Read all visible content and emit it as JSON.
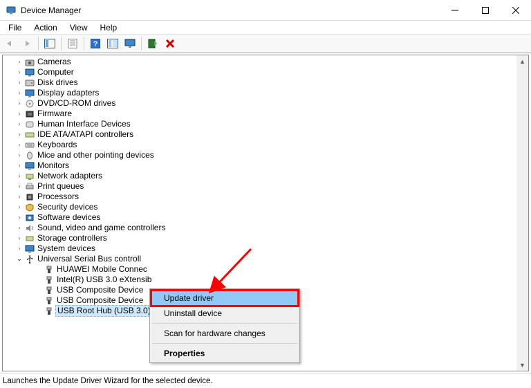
{
  "window": {
    "title": "Device Manager",
    "icon_name": "device-manager-icon"
  },
  "menus": [
    "File",
    "Action",
    "View",
    "Help"
  ],
  "toolbar_buttons": [
    {
      "name": "back-button",
      "icon": "arrow-left",
      "disabled": true
    },
    {
      "name": "forward-button",
      "icon": "arrow-right",
      "disabled": true
    },
    {
      "name": "sep"
    },
    {
      "name": "show-hide-console-tree-button",
      "icon": "pane-tree",
      "disabled": false
    },
    {
      "name": "sep"
    },
    {
      "name": "properties-button",
      "icon": "properties",
      "disabled": false
    },
    {
      "name": "sep"
    },
    {
      "name": "help-button",
      "icon": "help",
      "disabled": false
    },
    {
      "name": "show-all-button",
      "icon": "pane-all",
      "disabled": false
    },
    {
      "name": "show-monitor-button",
      "icon": "monitor",
      "disabled": false
    },
    {
      "name": "sep"
    },
    {
      "name": "scan-hardware-button",
      "icon": "scan",
      "disabled": false
    },
    {
      "name": "uninstall-button",
      "icon": "uninstall",
      "disabled": false
    }
  ],
  "tree": {
    "categories": [
      {
        "label": "Cameras",
        "icon": "camera-icon"
      },
      {
        "label": "Computer",
        "icon": "computer-icon"
      },
      {
        "label": "Disk drives",
        "icon": "disk-icon"
      },
      {
        "label": "Display adapters",
        "icon": "display-icon"
      },
      {
        "label": "DVD/CD-ROM drives",
        "icon": "dvd-icon"
      },
      {
        "label": "Firmware",
        "icon": "firmware-icon"
      },
      {
        "label": "Human Interface Devices",
        "icon": "hid-icon"
      },
      {
        "label": "IDE ATA/ATAPI controllers",
        "icon": "ide-icon"
      },
      {
        "label": "Keyboards",
        "icon": "keyboard-icon"
      },
      {
        "label": "Mice and other pointing devices",
        "icon": "mouse-icon"
      },
      {
        "label": "Monitors",
        "icon": "monitor-icon"
      },
      {
        "label": "Network adapters",
        "icon": "network-icon"
      },
      {
        "label": "Print queues",
        "icon": "printer-icon"
      },
      {
        "label": "Processors",
        "icon": "cpu-icon"
      },
      {
        "label": "Security devices",
        "icon": "security-icon"
      },
      {
        "label": "Software devices",
        "icon": "software-icon"
      },
      {
        "label": "Sound, video and game controllers",
        "icon": "sound-icon"
      },
      {
        "label": "Storage controllers",
        "icon": "storage-icon"
      },
      {
        "label": "System devices",
        "icon": "system-icon"
      }
    ],
    "expanded_category_label": "Universal Serial Bus controll",
    "expanded_category_icon": "usb-icon",
    "usb_children": [
      {
        "label": "HUAWEI Mobile Connec",
        "selected": false
      },
      {
        "label": "Intel(R) USB 3.0 eXtensib",
        "selected": false
      },
      {
        "label": "USB Composite Device",
        "selected": false
      },
      {
        "label": "USB Composite Device",
        "selected": false
      },
      {
        "label": "USB Root Hub (USB 3.0)",
        "selected": true
      }
    ]
  },
  "context_menu": {
    "items": [
      {
        "label": "Update driver",
        "selected": true,
        "highlight": true,
        "bold": false
      },
      {
        "label": "Uninstall device",
        "selected": false,
        "highlight": false,
        "bold": false
      },
      {
        "sep": true
      },
      {
        "label": "Scan for hardware changes",
        "selected": false,
        "highlight": false,
        "bold": false
      },
      {
        "sep": true
      },
      {
        "label": "Properties",
        "selected": false,
        "highlight": false,
        "bold": true
      }
    ]
  },
  "status_text": "Launches the Update Driver Wizard for the selected device.",
  "colors": {
    "selection_tree": "#cde8ff",
    "selection_menu": "#90c8f6",
    "highlight_box": "#ff0000",
    "arrow": "#ff0000"
  }
}
